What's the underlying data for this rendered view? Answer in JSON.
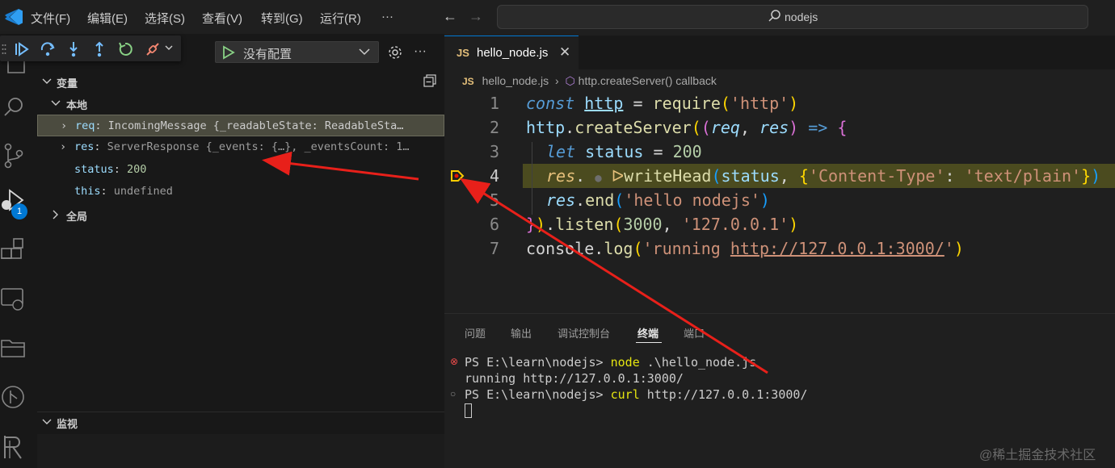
{
  "titlebar": {
    "menus": [
      "文件(F)",
      "编辑(E)",
      "选择(S)",
      "查看(V)",
      "转到(G)",
      "运行(R)",
      "···"
    ],
    "search_text": "nodejs"
  },
  "activity": {
    "debug_badge": "1"
  },
  "debug_config": {
    "selected": "没有配置"
  },
  "sidebar": {
    "variables_title": "变量",
    "local_title": "本地",
    "global_title": "全局",
    "watch_title": "监视",
    "locals": [
      {
        "name": "req",
        "value": "IncomingMessage {_readableState: ReadableSta…"
      },
      {
        "name": "res",
        "value": "ServerResponse {_events: {…}, _eventsCount: 1…"
      },
      {
        "name": "status",
        "value": "200"
      },
      {
        "name": "this",
        "value": "undefined"
      }
    ]
  },
  "editor": {
    "tab_badge": "JS",
    "tab_label": "hello_node.js",
    "breadcrumb_file": "hello_node.js",
    "breadcrumb_symbol": "http.createServer() callback",
    "line_numbers": [
      "1",
      "2",
      "3",
      "4",
      "5",
      "6",
      "7"
    ]
  },
  "panel": {
    "tabs": [
      "问题",
      "输出",
      "调试控制台",
      "终端",
      "端口"
    ],
    "active_tab": "终端",
    "terminal": [
      {
        "prompt": "PS E:\\learn\\nodejs> ",
        "cmd_a": "node",
        "cmd_b": " .\\hello_node.js"
      },
      {
        "text": "running http://127.0.0.1:3000/"
      },
      {
        "prompt": "PS E:\\learn\\nodejs> ",
        "cmd_a": "curl",
        "cmd_b": " http://127.0.0.1:3000/"
      }
    ]
  },
  "watermark": "@稀土掘金技术社区",
  "colors": {
    "accent": "#0078d4",
    "debug_line": "#4b4b1f",
    "arrow": "#e8201a"
  }
}
